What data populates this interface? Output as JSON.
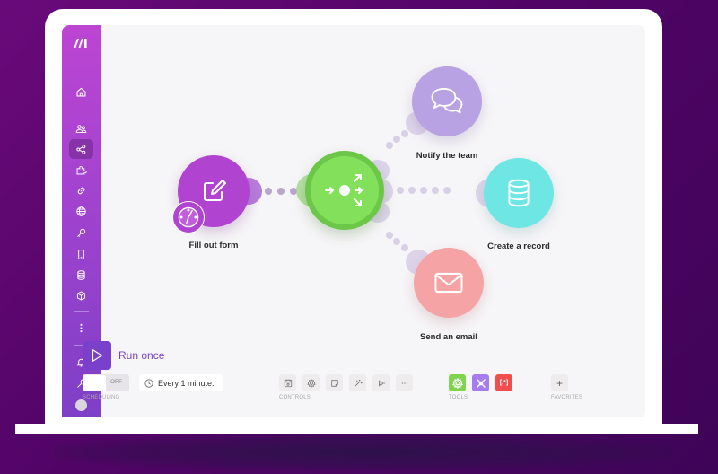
{
  "app": {
    "name": "Make",
    "logo_icon": "make-logo"
  },
  "sidebar": {
    "items": [
      {
        "id": "home",
        "icon": "home-icon",
        "active": false
      },
      {
        "id": "team",
        "icon": "users-icon",
        "active": false
      },
      {
        "id": "scenarios",
        "icon": "share-nodes-icon",
        "active": true
      },
      {
        "id": "templates",
        "icon": "puzzle-icon",
        "active": false
      },
      {
        "id": "connections",
        "icon": "link-icon",
        "active": false
      },
      {
        "id": "webhooks",
        "icon": "globe-icon",
        "active": false
      },
      {
        "id": "keys",
        "icon": "key-icon",
        "active": false
      },
      {
        "id": "devices",
        "icon": "mobile-icon",
        "active": false
      },
      {
        "id": "data-stores",
        "icon": "database-icon",
        "active": false
      },
      {
        "id": "data-structures",
        "icon": "cube-icon",
        "active": false
      },
      {
        "id": "more",
        "icon": "more-vertical-icon",
        "active": false
      },
      {
        "id": "notifications",
        "icon": "bell-icon",
        "active": false
      },
      {
        "id": "resources",
        "icon": "wrench-icon",
        "active": false
      },
      {
        "id": "profile",
        "icon": "avatar",
        "active": false
      }
    ]
  },
  "scenario": {
    "nodes": [
      {
        "id": "trigger",
        "label": "Fill out form",
        "icon": "form-edit-icon",
        "color": "#b044d0",
        "badge_icon": "clock-icon"
      },
      {
        "id": "router",
        "label": "",
        "icon": "router-icon",
        "color": "#7ed957"
      },
      {
        "id": "notify",
        "label": "Notify the team",
        "icon": "chat-bubbles-icon",
        "color": "#b9a2e4"
      },
      {
        "id": "record",
        "label": "Create a record",
        "icon": "database-icon",
        "color": "#6ee6e4"
      },
      {
        "id": "email",
        "label": "Send an email",
        "icon": "envelope-icon",
        "color": "#f5a3a5"
      }
    ]
  },
  "toolbar": {
    "run_once_label": "Run once",
    "scheduling": {
      "toggle_state": "OFF",
      "interval": "Every 1 minute.",
      "group_label": "SCHEDULING"
    },
    "controls": {
      "group_label": "CONTROLS",
      "items": [
        {
          "id": "save",
          "icon": "save-icon"
        },
        {
          "id": "settings",
          "icon": "gear-icon"
        },
        {
          "id": "notes",
          "icon": "note-icon"
        },
        {
          "id": "auto-align",
          "icon": "magic-wand-icon"
        },
        {
          "id": "explain-flow",
          "icon": "flow-icon"
        },
        {
          "id": "more",
          "icon": "more-horizontal-icon"
        }
      ]
    },
    "tools": {
      "group_label": "TOOLS",
      "items": [
        {
          "id": "flow-control",
          "icon": "gear-icon",
          "color": "#7fd34e"
        },
        {
          "id": "tools",
          "icon": "tools-icon",
          "color": "#a77cf0"
        },
        {
          "id": "text-parser",
          "icon": "brackets-icon",
          "color": "#f04e4e",
          "text": "[.*]"
        }
      ]
    },
    "favorites": {
      "group_label": "FAVORITES",
      "add_label": "+"
    }
  },
  "colors": {
    "accent": "#7a3fcb",
    "sidebar_top": "#bd45d3",
    "sidebar_bottom": "#7e3fc6",
    "canvas_bg": "#f6f5f7",
    "background": "#510466"
  }
}
